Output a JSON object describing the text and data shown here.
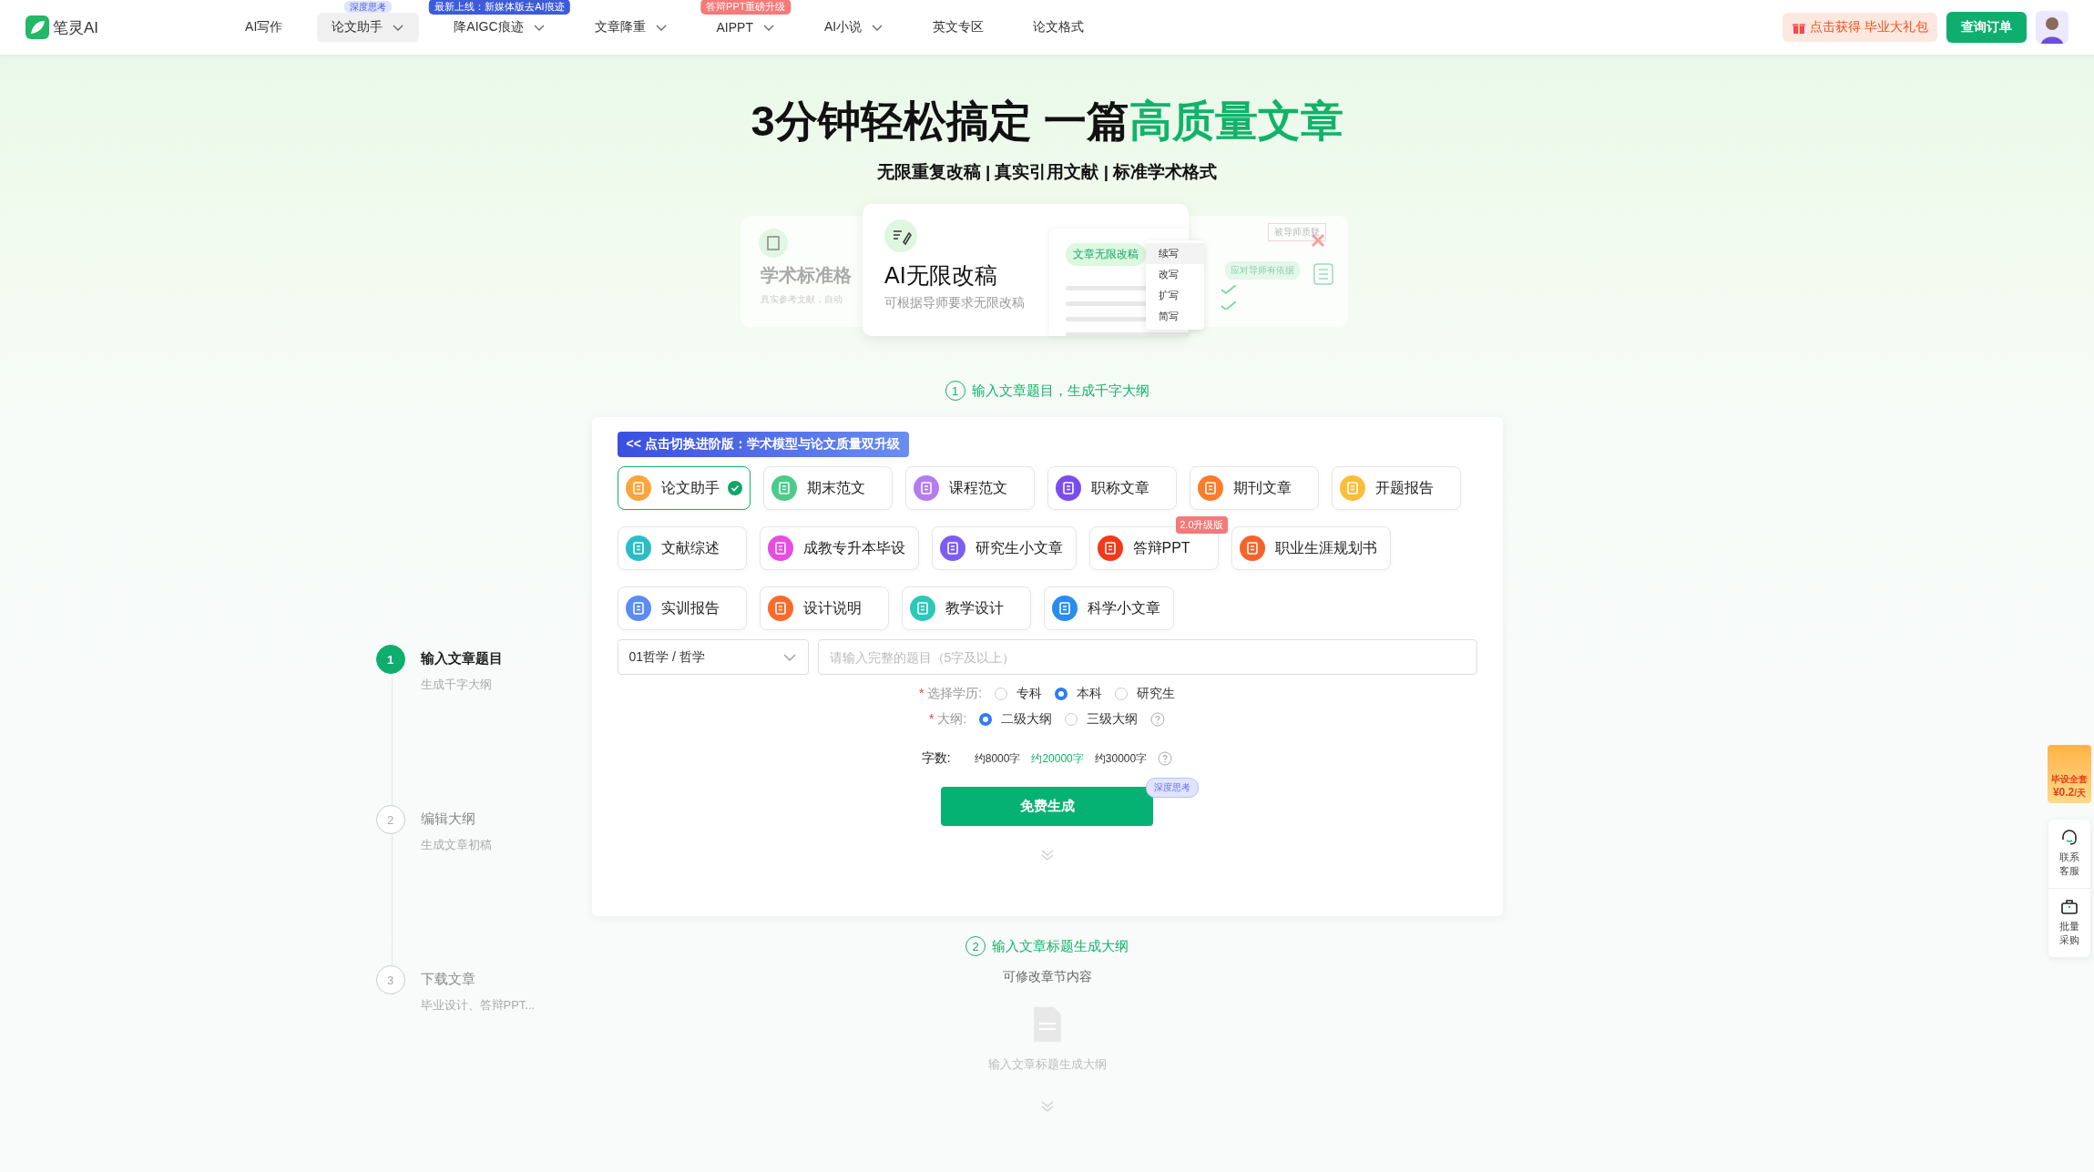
{
  "nav": {
    "logo": "笔灵AI",
    "items": [
      {
        "label": "AI写作",
        "selected": false,
        "dropdown": false
      },
      {
        "label": "论文助手",
        "selected": true,
        "dropdown": true,
        "badge": {
          "text": "深度思考",
          "color": "#dfe4ff"
        }
      },
      {
        "label": "降AIGC痕迹",
        "selected": false,
        "dropdown": true,
        "badge": {
          "text": "最新上线：新媒体版去AI痕迹",
          "color": "#3d5bd9"
        }
      },
      {
        "label": "文章降重",
        "selected": false,
        "dropdown": true
      },
      {
        "label": "AIPPT",
        "selected": false,
        "dropdown": true,
        "badge": {
          "text": "答辩PPT重磅升级",
          "color": "#f47a7a"
        }
      },
      {
        "label": "AI小说",
        "selected": false,
        "dropdown": true
      },
      {
        "label": "英文专区",
        "selected": false,
        "dropdown": false
      },
      {
        "label": "论文格式",
        "selected": false,
        "dropdown": false
      }
    ],
    "gift_button": "点击获得 毕业大礼包",
    "order_button": "查询订单"
  },
  "hero": {
    "title": "3分钟轻松搞定 一篇",
    "title_highlight": "高质量文章",
    "subtitle": "无限重复改稿 | 真实引用文献 | 标准学术格式"
  },
  "feature_cards": {
    "left": {
      "title": "学术标准格",
      "text": "真实参考文献，自动"
    },
    "center": {
      "title": "AI无限改稿",
      "text": "可根据导师要求无限改稿",
      "tag": "文章无限改稿",
      "menu": [
        "续写",
        "改写",
        "扩写",
        "简写"
      ]
    },
    "right": {
      "note": "被导师质疑",
      "tag": "应对导师有依据"
    }
  },
  "step1_heading": {
    "number": "1",
    "text": "输入文章题目，生成千字大纲"
  },
  "form": {
    "upgrade_banner": "<< 点击切换进阶版：学术模型与论文质量双升级",
    "types": [
      {
        "label": "论文助手",
        "selected": true,
        "color": "#fba53a"
      },
      {
        "label": "期末范文",
        "selected": false,
        "color": "#4ccb8a"
      },
      {
        "label": "课程范文",
        "selected": false,
        "color": "#b47cf0"
      },
      {
        "label": "职称文章",
        "selected": false,
        "color": "#7a4cf0"
      },
      {
        "label": "期刊文章",
        "selected": false,
        "color": "#fb7d2a"
      },
      {
        "label": "开题报告",
        "selected": false,
        "color": "#fbbd3a"
      },
      {
        "label": "文献综述",
        "selected": false,
        "color": "#2cbcc8"
      },
      {
        "label": "成教专升本毕设",
        "selected": false,
        "color": "#e94ce0"
      },
      {
        "label": "研究生小文章",
        "selected": false,
        "color": "#7d5cf0"
      },
      {
        "label": "答辩PPT",
        "selected": false,
        "color": "#f03a1a",
        "badge": "2.0升级版"
      },
      {
        "label": "职业生涯规划书",
        "selected": false,
        "color": "#f5632a"
      },
      {
        "label": "实训报告",
        "selected": false,
        "color": "#5b8cf5"
      },
      {
        "label": "设计说明",
        "selected": false,
        "color": "#fb6a2a"
      },
      {
        "label": "教学设计",
        "selected": false,
        "color": "#2cc8b8"
      },
      {
        "label": "科学小文章",
        "selected": false,
        "color": "#2a8cf0"
      }
    ],
    "subject_select": "01哲学 / 哲学",
    "title_placeholder": "请输入完整的题目（5字及以上）",
    "education": {
      "required_mark": "*",
      "label": "选择学历:",
      "options": [
        {
          "label": "专科",
          "selected": false
        },
        {
          "label": "本科",
          "selected": true
        },
        {
          "label": "研究生",
          "selected": false
        }
      ]
    },
    "outline": {
      "required_mark": "*",
      "label": "大纲:",
      "options": [
        {
          "label": "二级大纲",
          "selected": true
        },
        {
          "label": "三级大纲",
          "selected": false
        }
      ]
    },
    "word_count": {
      "label": "字数:",
      "options": [
        {
          "label": "约8000字",
          "selected": false
        },
        {
          "label": "约20000字",
          "selected": true
        },
        {
          "label": "约30000字",
          "selected": false
        }
      ]
    },
    "generate_button": "免费生成",
    "generate_badge": "深度思考"
  },
  "steps": [
    {
      "number": "1",
      "title": "输入文章题目",
      "subtitle": "生成千字大纲",
      "selected": true
    },
    {
      "number": "2",
      "title": "编辑大纲",
      "subtitle": "生成文章初稿",
      "selected": false
    },
    {
      "number": "3",
      "title": "下载文章",
      "subtitle": "毕业设计、答辩PPT...",
      "selected": false
    }
  ],
  "step2": {
    "number": "2",
    "heading": "输入文章标题生成大纲",
    "subtitle": "可修改章节内容",
    "empty_text": "输入文章标题生成大纲"
  },
  "side": {
    "promo_title": "毕设全套",
    "promo_price": "¥0.2",
    "promo_unit": "/天",
    "buttons": [
      "联系客服",
      "批量采购"
    ]
  }
}
